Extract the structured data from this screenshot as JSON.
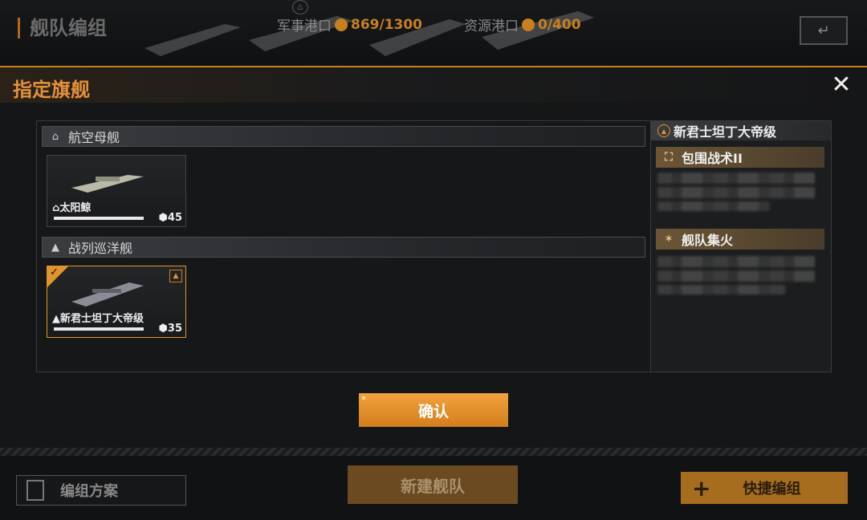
{
  "background": {
    "title": "舰队编组",
    "military_port": {
      "label": "军事港口",
      "value": "869/1300"
    },
    "resource_port": {
      "label": "资源港口",
      "value": "0/400"
    },
    "plan_button": "编组方案",
    "new_fleet_button": "新建舰队",
    "quick_button": "快捷编组"
  },
  "modal": {
    "title": "指定旗舰",
    "confirm_label": "确认",
    "categories": [
      {
        "label": "航空母舰",
        "icon": "carrier-icon",
        "ships": [
          {
            "name": "太阳鲸",
            "cost": "45",
            "selected": false
          }
        ]
      },
      {
        "label": "战列巡洋舰",
        "icon": "battlecruiser-icon",
        "ships": [
          {
            "name": "新君士坦丁大帝级",
            "cost": "35",
            "selected": true
          }
        ]
      }
    ],
    "detail": {
      "ship_name": "新君士坦丁大帝级",
      "skills": [
        {
          "name": "包围战术II",
          "icon": "encircle-icon"
        },
        {
          "name": "舰队集火",
          "icon": "focus-fire-icon"
        }
      ]
    }
  },
  "colors": {
    "accent": "#e0952c",
    "title": "#e4903a"
  }
}
